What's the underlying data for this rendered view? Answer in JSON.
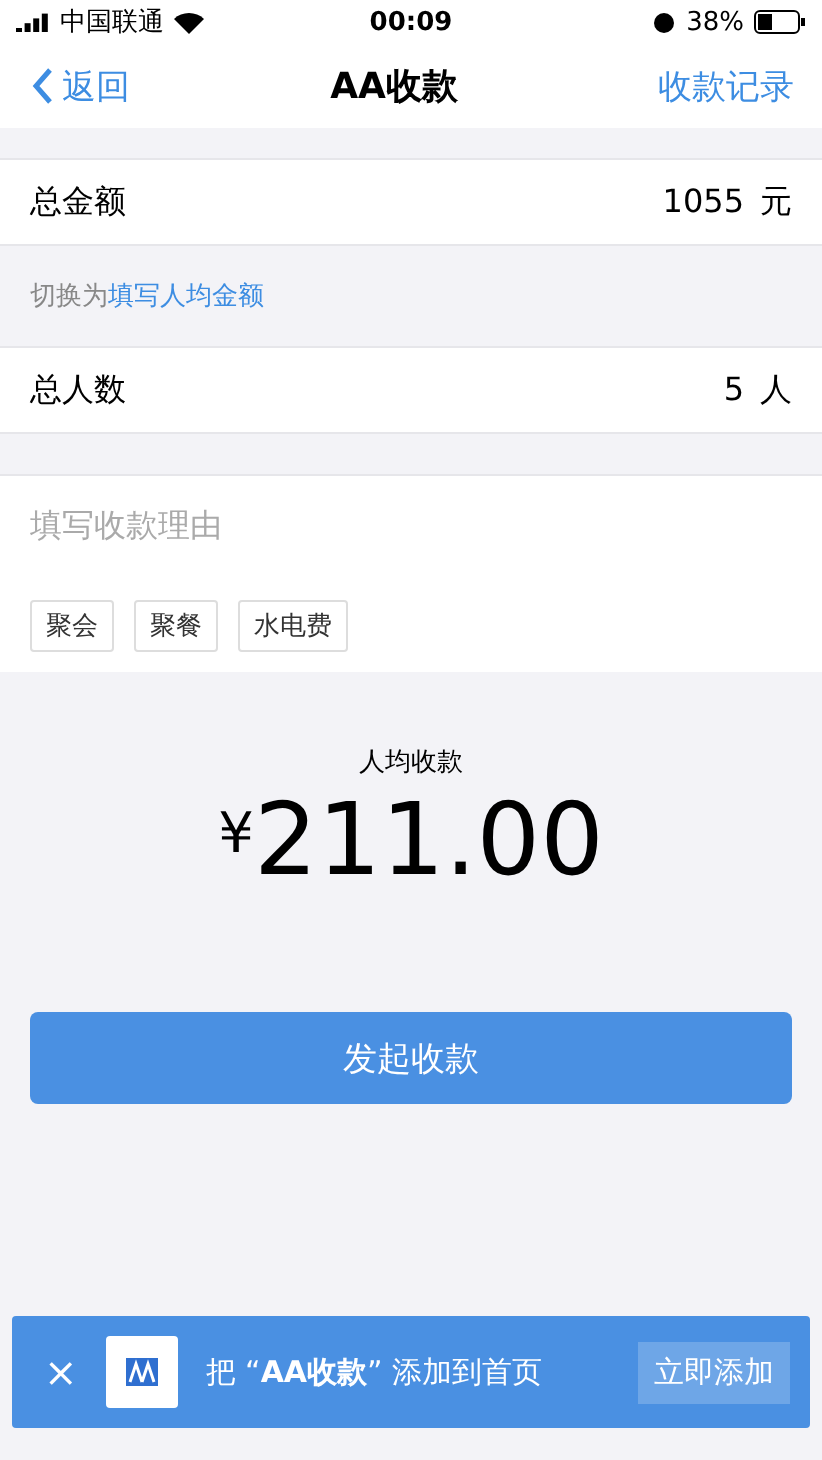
{
  "status_bar": {
    "carrier": "中国联通",
    "time": "00:09",
    "battery": "38%"
  },
  "nav": {
    "back": "返回",
    "title": "AA收款",
    "right": "收款记录"
  },
  "total": {
    "label": "总金额",
    "value": "1055",
    "unit": "元"
  },
  "switch": {
    "prefix": "切换为",
    "link": "填写人均金额"
  },
  "people": {
    "label": "总人数",
    "value": "5",
    "unit": "人"
  },
  "reason": {
    "placeholder": "填写收款理由",
    "tags": [
      "聚会",
      "聚餐",
      "水电费"
    ]
  },
  "average": {
    "label": "人均收款",
    "currency": "¥",
    "amount": "211.00"
  },
  "submit": "发起收款",
  "banner": {
    "close": "×",
    "text": "把 “**AA收款**” 添加到首页",
    "button": "立即添加"
  }
}
